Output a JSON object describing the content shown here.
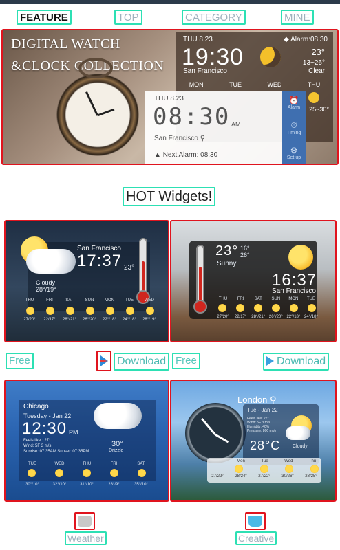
{
  "tabs": [
    {
      "label": "FEATURE",
      "active": true
    },
    {
      "label": "TOP",
      "active": false
    },
    {
      "label": "CATEGORY",
      "active": false
    },
    {
      "label": "MINE",
      "active": false
    }
  ],
  "banner": {
    "title_line1": "DIGITAL WATCH",
    "title_line2": "&CLOCK COLLECTION",
    "weather_card": {
      "date": "THU 8.23",
      "alarm": "Alarm:08:30",
      "time": "19:30",
      "city": "San Francisco",
      "temp": "23°",
      "range": "13~26°",
      "condition": "Clear",
      "days": [
        "MON",
        "TUE",
        "WED",
        "THU"
      ],
      "last_range": "25~30°"
    },
    "clock_card": {
      "date": "THU 8.23",
      "time": "08:30",
      "ampm": "AM",
      "city": "San Francisco",
      "next_alarm": "Next Alarm: 08:30",
      "side_buttons": [
        {
          "label": "Alarm",
          "icon": "alarm-clock-icon"
        },
        {
          "label": "Timing",
          "icon": "stopwatch-icon"
        },
        {
          "label": "Set up",
          "icon": "gear-icon"
        }
      ]
    }
  },
  "hot_title": "HOT Widgets!",
  "widgets": [
    {
      "city": "San Francisco",
      "time": "17:37",
      "temp": "23°",
      "condition": "Cloudy",
      "range": "28°/19°",
      "days": [
        "THU",
        "FRI",
        "SAT",
        "SUN",
        "MON",
        "TUE",
        "WED"
      ],
      "ranges": [
        "27/20°",
        "22/17°",
        "28°/21°",
        "26°/20°",
        "22°/18°",
        "24°/18°",
        "28°/19°"
      ]
    },
    {
      "temp": "23°",
      "hi": "16°",
      "lo": "26°",
      "condition": "Sunny",
      "time": "16:37",
      "city": "San Francisco",
      "days": [
        "THU",
        "FRI",
        "SAT",
        "SUN",
        "MON",
        "TUE",
        "WED"
      ],
      "ranges": [
        "27/20°",
        "22/17°",
        "28°/21°",
        "26°/20°",
        "22°/18°",
        "24°/18°"
      ]
    },
    {
      "city": "Chicago",
      "date": "Tuesday - Jan 22",
      "time": "12:30",
      "ampm": "PM",
      "temp": "30°",
      "condition": "Drizzle",
      "feels": "Feels like : 27°",
      "wind": "Wind: 5F 3 m/s",
      "sun": "Sunrise: 07:35AM     Sunset: 07:35PM",
      "days": [
        "TUE",
        "WED",
        "THU",
        "FRI",
        "SAT"
      ],
      "ranges": [
        "30°/10°",
        "32°/10°",
        "31°/10°",
        "28°/9°",
        "35°/10°"
      ]
    },
    {
      "city": "London",
      "date": "Tue - Jan 22",
      "temp": "28°C",
      "condition": "Cloudy",
      "details": [
        "Feels like: 27°",
        "Wind: 5F 3 m/s",
        "Humidity: 40%",
        "Pressure: 800 mph"
      ],
      "days": [
        "Mon",
        "Tue",
        "Wed",
        "Thu"
      ],
      "ranges": [
        "27/22°",
        "28/24°",
        "27/22°",
        "30/26°",
        "28/25°"
      ]
    }
  ],
  "row1": {
    "left_price": "Free",
    "right_price": "Free",
    "download_label": "Download"
  },
  "bottom_nav": [
    {
      "label": "Weather",
      "icon": "weather-cloud-icon",
      "color": "#c9c9c9"
    },
    {
      "label": "Creative",
      "icon": "creative-tshirt-icon",
      "color": "#4ab9e6"
    }
  ],
  "colors": {
    "accent_border": "#2de0b4",
    "card_border": "#e0141e",
    "tab_text": "#9fb1bd",
    "download_text": "#4ab9b1"
  }
}
